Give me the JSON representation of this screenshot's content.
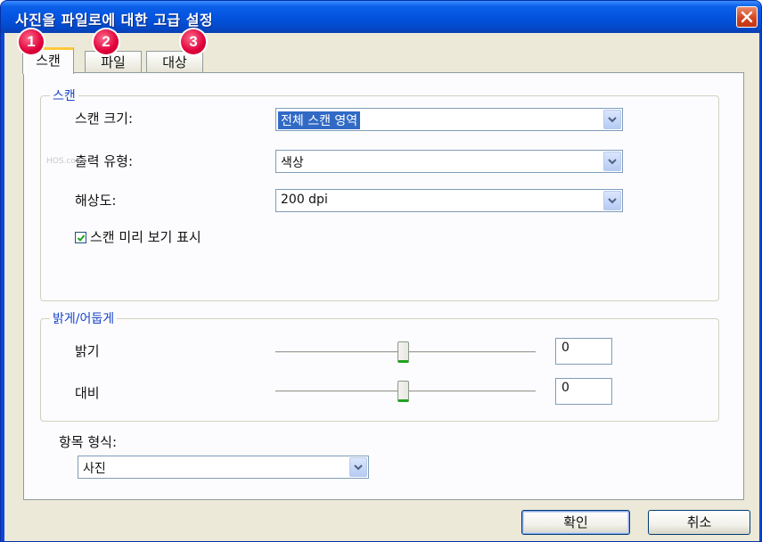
{
  "window": {
    "title": "사진을 파일로에 대한 고급 설정"
  },
  "tabs": [
    {
      "label": "스캔",
      "badge": "1",
      "active": true
    },
    {
      "label": "파일",
      "badge": "2",
      "active": false
    },
    {
      "label": "대상",
      "badge": "3",
      "active": false
    }
  ],
  "scan_group": {
    "title": "스캔",
    "scan_size_label": "스캔 크기:",
    "scan_size_value": "전체 스캔 영역",
    "output_type_label": "출력 유형:",
    "output_type_value": "색상",
    "resolution_label": "해상도:",
    "resolution_value": "200 dpi",
    "preview_checkbox_label": "스캔 미리 보기 표시",
    "preview_checked": true
  },
  "brightness_group": {
    "title": "밝게/어둡게",
    "brightness_label": "밝기",
    "brightness_value": "0",
    "contrast_label": "대비",
    "contrast_value": "0"
  },
  "item_format": {
    "label": "항목 형식:",
    "value": "사진"
  },
  "buttons": {
    "ok": "확인",
    "cancel": "취소"
  },
  "watermark": "HOS.co.kr",
  "colors": {
    "title_bar": "#0454e0",
    "client_bg": "#ece9d8",
    "group_title": "#1a46c8",
    "active_tab_accent": "#ffc83c",
    "badge": "#e0003a",
    "selection": "#316ac5",
    "close_button": "#d0421e"
  }
}
